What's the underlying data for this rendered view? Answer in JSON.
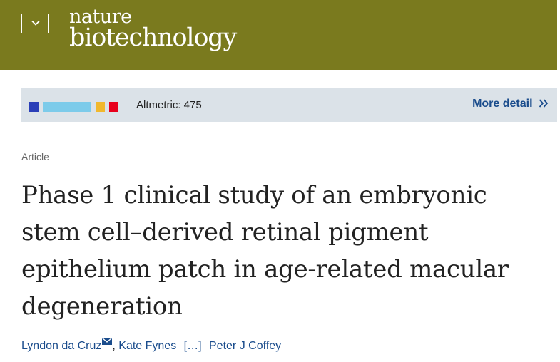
{
  "header": {
    "menu_icon": "chevron-down-icon",
    "logo_line1": "nature",
    "logo_line2": "biotechnology",
    "background": "#7a7a1e"
  },
  "altmetric": {
    "label": "Altmetric: 475",
    "more_detail": "More detail",
    "more_icon": "double-chevron-right-icon",
    "swatches": [
      "#2a3fb8",
      "#7ccbea",
      "#f1b82d",
      "#e8001c"
    ]
  },
  "article": {
    "type": "Article",
    "title": "Phase 1 clinical study of an embryonic stem cell–derived retinal pigment epithelium patch in age-related macular degeneration",
    "authors": {
      "first": "Lyndon da Cruz",
      "second": "Kate Fynes",
      "ellipsis": "[…]",
      "last": "Peter J Coffey",
      "email_icon": "envelope-icon"
    }
  }
}
